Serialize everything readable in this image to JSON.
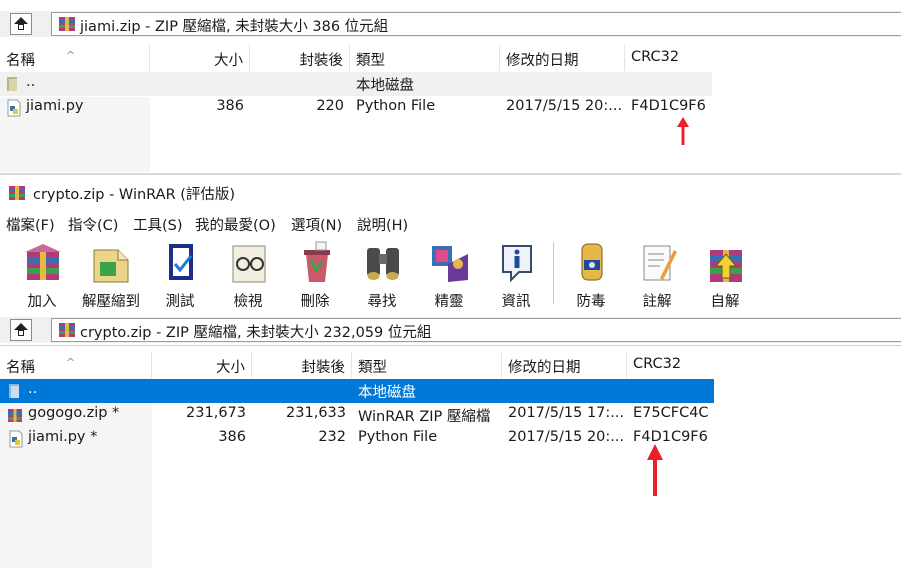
{
  "top_window": {
    "path": "jiami.zip - ZIP 壓縮檔, 未封裝大小 386 位元組",
    "columns": [
      "名稱",
      "大小",
      "封裝後",
      "類型",
      "修改的日期",
      "CRC32"
    ],
    "rows": [
      {
        "name": "..",
        "size": "",
        "packed": "",
        "type": "本地磁盘",
        "modified": "",
        "crc": ""
      },
      {
        "name": "jiami.py",
        "size": "386",
        "packed": "220",
        "type": "Python File",
        "modified": "2017/5/15 20:...",
        "crc": "F4D1C9F6"
      }
    ]
  },
  "bottom_window": {
    "title": "crypto.zip - WinRAR (評估版)",
    "menu": [
      "檔案(F)",
      "指令(C)",
      "工具(S)",
      "我的最愛(O)",
      "選項(N)",
      "說明(H)"
    ],
    "toolbar": [
      {
        "label": "加入",
        "icon": "add-icon"
      },
      {
        "label": "解壓縮到",
        "icon": "extract-icon"
      },
      {
        "label": "測試",
        "icon": "test-icon"
      },
      {
        "label": "檢視",
        "icon": "view-icon"
      },
      {
        "label": "刪除",
        "icon": "delete-icon"
      },
      {
        "label": "尋找",
        "icon": "find-icon"
      },
      {
        "label": "精靈",
        "icon": "wizard-icon"
      },
      {
        "label": "資訊",
        "icon": "info-icon"
      },
      {
        "label": "防毒",
        "icon": "virus-scan-icon"
      },
      {
        "label": "註解",
        "icon": "comment-icon"
      },
      {
        "label": "自解",
        "icon": "sfx-icon"
      }
    ],
    "path": "crypto.zip - ZIP 壓縮檔, 未封裝大小 232,059 位元組",
    "columns": [
      "名稱",
      "大小",
      "封裝後",
      "類型",
      "修改的日期",
      "CRC32"
    ],
    "rows": [
      {
        "name": "..",
        "size": "",
        "packed": "",
        "type": "本地磁盘",
        "modified": "",
        "crc": ""
      },
      {
        "name": "gogogo.zip *",
        "size": "231,673",
        "packed": "231,633",
        "type": "WinRAR ZIP 壓縮檔",
        "modified": "2017/5/15 17:...",
        "crc": "E75CFC4C"
      },
      {
        "name": "jiami.py *",
        "size": "386",
        "packed": "232",
        "type": "Python File",
        "modified": "2017/5/15 20:...",
        "crc": "F4D1C9F6"
      }
    ]
  },
  "colors": {
    "selection": "#0078d7",
    "arrow": "#e8202a",
    "header_bg": "#ffffff",
    "panel_bg": "#f0f0f0"
  }
}
